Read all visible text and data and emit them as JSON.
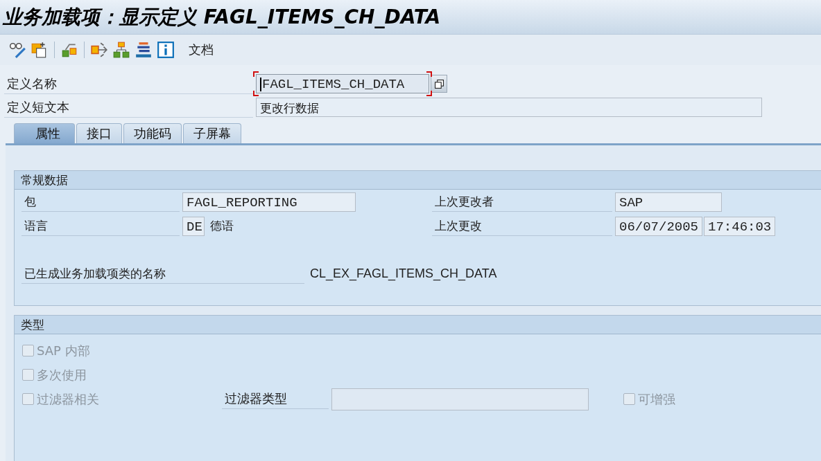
{
  "title": "业务加载项：显示定义 FAGL_ITEMS_CH_DATA",
  "toolbar": {
    "text_button": "文档"
  },
  "header": [
    {
      "label": "定义名称",
      "value": "FAGL_ITEMS_CH_DATA",
      "focused": true
    },
    {
      "label": "定义短文本",
      "value": "更改行数据",
      "focused": false
    }
  ],
  "tabs": [
    {
      "label": "属性",
      "selected": true
    },
    {
      "label": "接口",
      "selected": false
    },
    {
      "label": "功能码",
      "selected": false
    },
    {
      "label": "子屏幕",
      "selected": false
    }
  ],
  "general": {
    "title": "常规数据",
    "package": {
      "label": "包",
      "value": "FAGL_REPORTING"
    },
    "language": {
      "label": "语言",
      "code": "DE",
      "name": "德语"
    },
    "changed_by": {
      "label": "上次更改者",
      "value": "SAP"
    },
    "changed_on": {
      "label": "上次更改",
      "date": "06/07/2005",
      "time": "17:46:03"
    },
    "class_name": {
      "label": "已生成业务加载项类的名称",
      "value": "CL_EX_FAGL_ITEMS_CH_DATA"
    }
  },
  "type": {
    "title": "类型",
    "options": [
      {
        "label": "SAP 内部",
        "checked": false,
        "disabled": true
      },
      {
        "label": "多次使用",
        "checked": false,
        "disabled": true
      },
      {
        "label": "过滤器相关",
        "checked": false,
        "disabled": true
      }
    ],
    "filter_type": {
      "label": "过滤器类型"
    },
    "enhanceable": {
      "label": "可增强",
      "checked": false,
      "disabled": true
    }
  }
}
